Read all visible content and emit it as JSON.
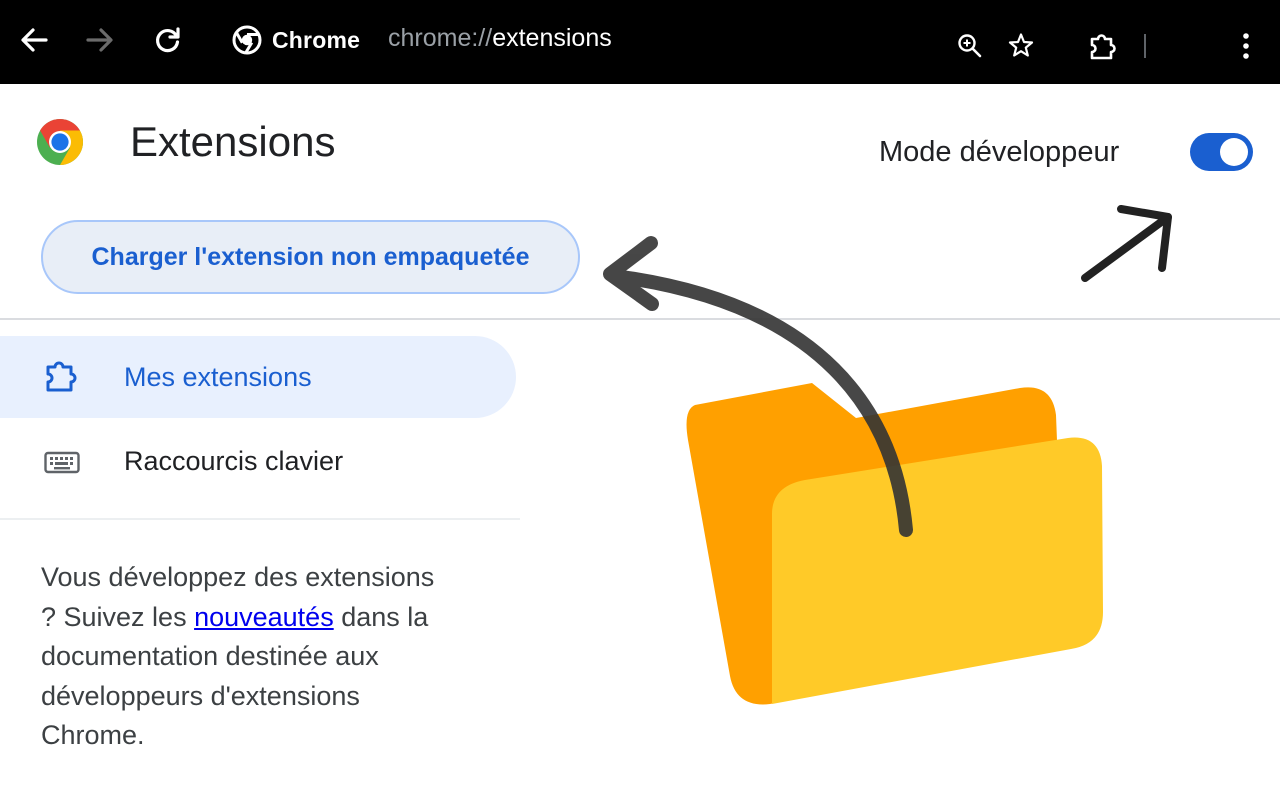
{
  "browser": {
    "site_name": "Chrome",
    "url_scheme": "chrome://",
    "url_path": "extensions",
    "back_icon": "arrow-left-icon",
    "forward_icon": "arrow-right-icon",
    "reload_icon": "reload-icon",
    "zoom_icon": "zoom-in-icon",
    "bookmark_icon": "star-icon",
    "extensions_icon": "puzzle-icon",
    "menu_icon": "kebab-menu-icon"
  },
  "header": {
    "title": "Extensions",
    "developer_mode_label": "Mode développeur",
    "developer_mode_on": true
  },
  "toolbar": {
    "load_unpacked_label": "Charger l'extension non empaquetée"
  },
  "sidebar": {
    "items": [
      {
        "label": "Mes extensions",
        "icon": "puzzle-icon",
        "active": true
      },
      {
        "label": "Raccourcis clavier",
        "icon": "keyboard-icon",
        "active": false
      }
    ]
  },
  "info": {
    "text_before": "Vous développez des extensions ? Suivez les ",
    "link_text": "nouveautés",
    "text_after": " dans la documentation destinée aux développeurs d'extensions Chrome."
  },
  "colors": {
    "accent_blue": "#1a5fd0",
    "folder_back": "#ffa000",
    "folder_front": "#ffca28",
    "topbar_bg": "#000000"
  }
}
